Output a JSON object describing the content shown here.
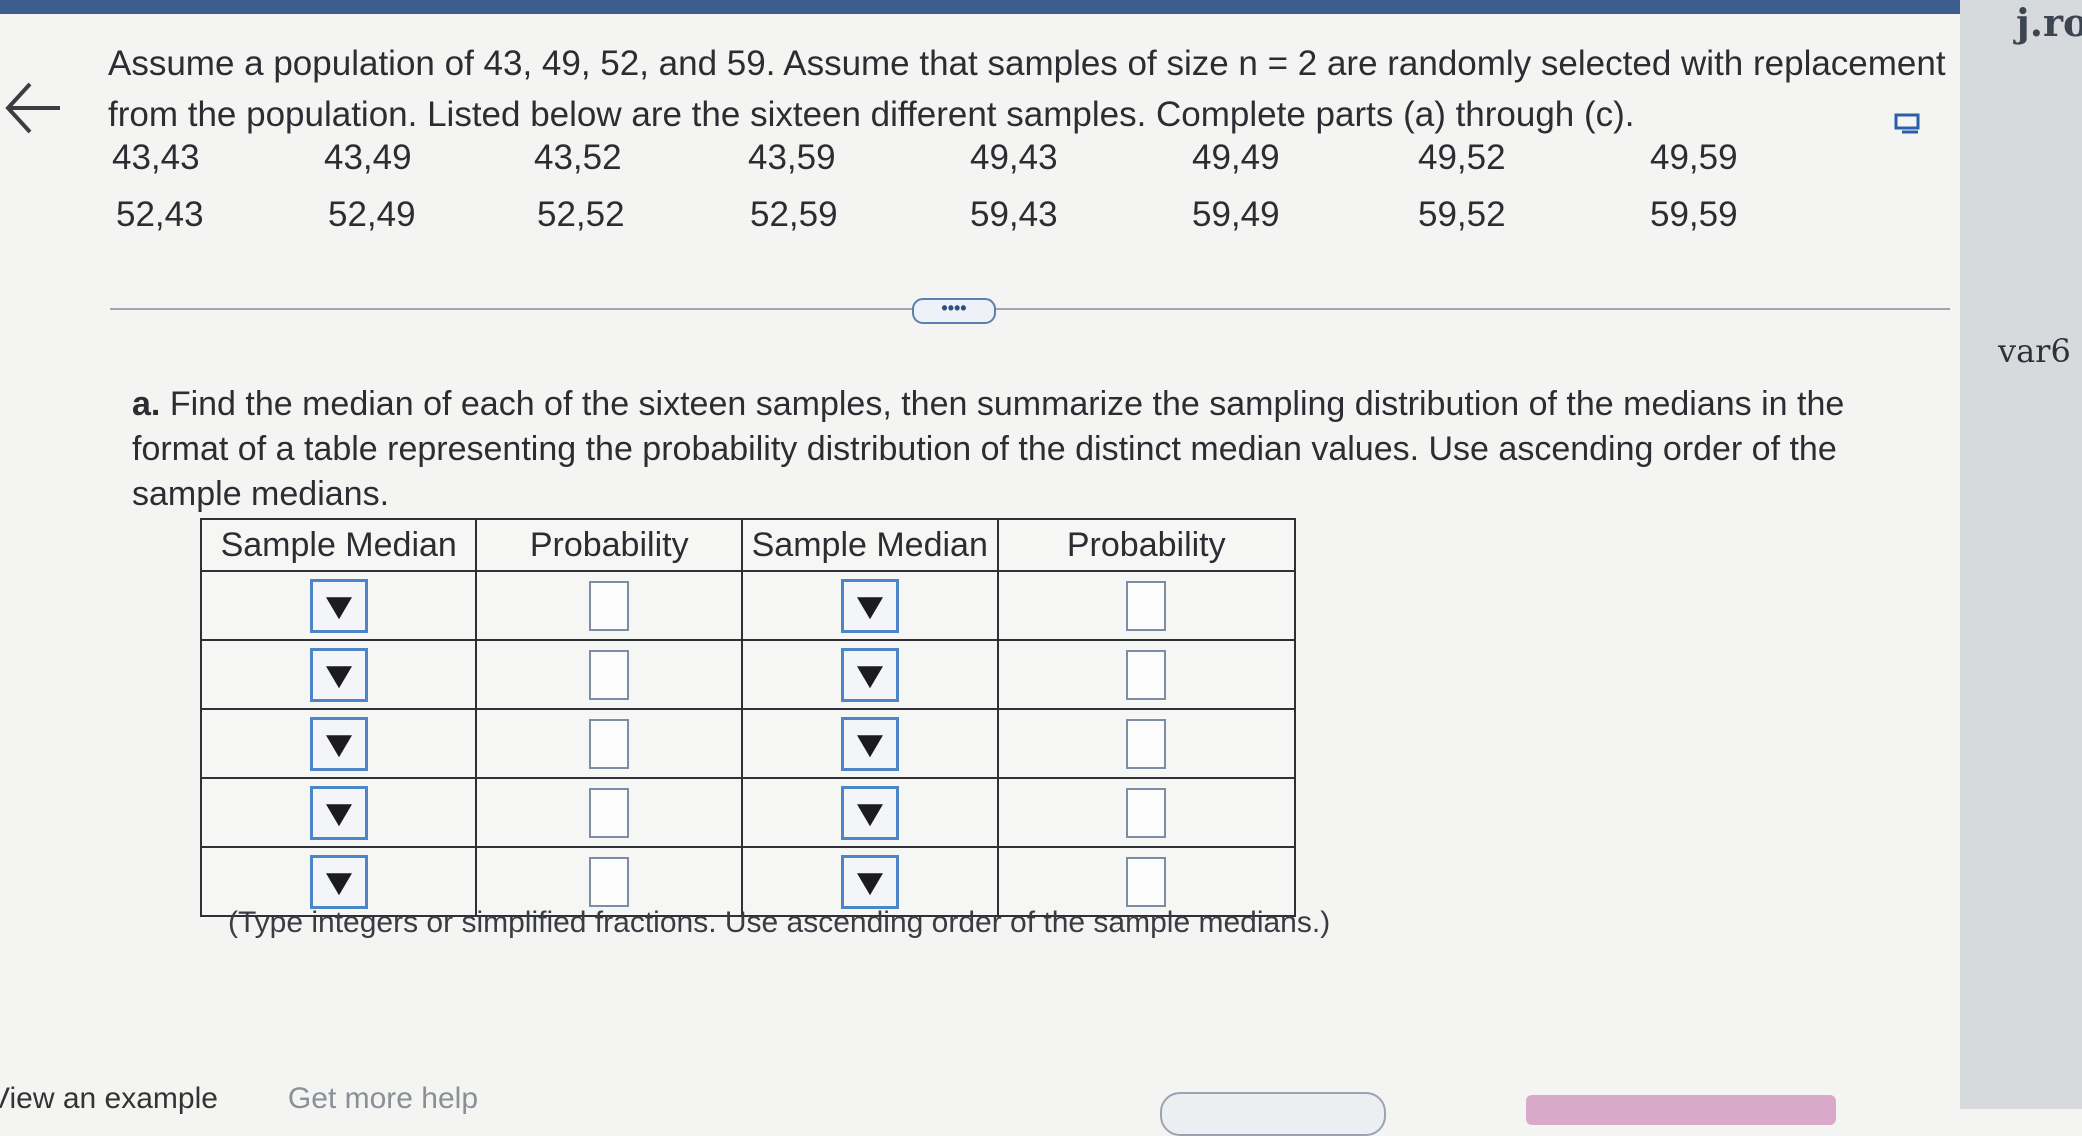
{
  "question": {
    "line1": "Assume a population of 43, 49, 52, and 59. Assume that samples of size n = 2 are randomly selected with replacement",
    "line2": "from the population. Listed below are the sixteen different samples. Complete parts (a) through (c).",
    "samples_row1": [
      "43,43",
      "43,49",
      "43,52",
      "43,59",
      "49,43",
      "49,49",
      "49,52",
      "49,59"
    ],
    "samples_row2": [
      "52,43",
      "52,49",
      "52,52",
      "52,59",
      "59,43",
      "59,49",
      "59,52",
      "59,59"
    ]
  },
  "more_button": "••••",
  "part_a": {
    "label": "a.",
    "line1": "Find the median of each of the sixteen samples, then summarize the sampling distribution of the medians in the",
    "line2": "format of a table representing the probability distribution of the distinct median values. Use ascending order of the",
    "line3": "sample medians."
  },
  "table": {
    "headers": [
      "Sample Median",
      "Probability",
      "Sample Median",
      "Probability"
    ],
    "row_count": 5
  },
  "hint": "(Type integers or simplified fractions. Use ascending order of the sample medians.)",
  "right_panel": {
    "title": "j.ro",
    "label": "var6"
  },
  "bottom": {
    "view_example": "View an example",
    "get_more_help": "Get more help"
  }
}
